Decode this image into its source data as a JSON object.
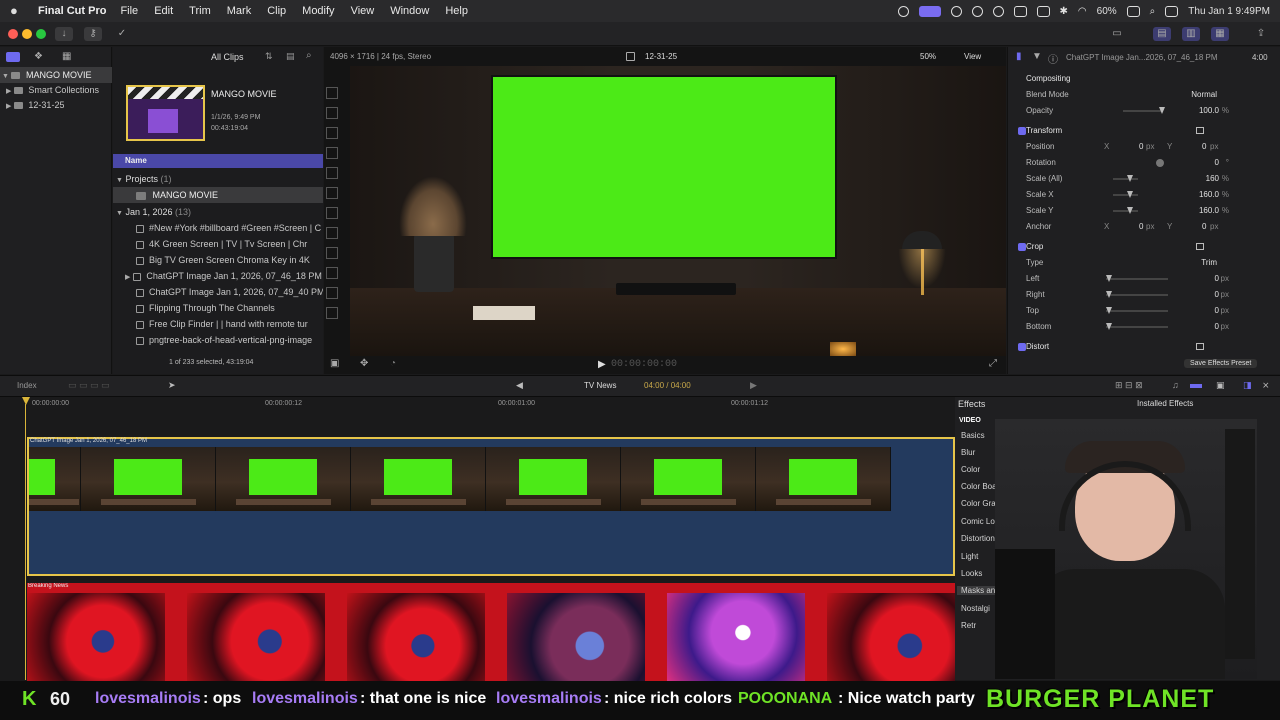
{
  "menubar": {
    "app_name": "Final Cut Pro",
    "items": [
      "File",
      "Edit",
      "Trim",
      "Mark",
      "Clip",
      "Modify",
      "View",
      "Window",
      "Help"
    ],
    "battery": "60%",
    "datetime": "Thu Jan 1  9:49PM"
  },
  "libraries": {
    "library": "MANGO MOVIE",
    "smart": "Smart Collections",
    "event": "12-31-25"
  },
  "browser": {
    "filter": "All Clips",
    "project_title": "MANGO MOVIE",
    "project_date": "1/1/26, 9:49 PM",
    "project_duration": "00:43:19:04",
    "column_name": "Name",
    "group_projects": "Projects",
    "group_projects_count": "(1)",
    "project_item": "MANGO MOVIE",
    "group_date": "Jan 1, 2026",
    "group_date_count": "(13)",
    "clips": [
      "#New #York #billboard #Green #Screen | C",
      "4K Green Screen  |  TV  |  Tv Screen  | Chr",
      "Big TV Green Screen Chroma Key in 4K",
      "ChatGPT Image Jan 1, 2026, 07_46_18 PM",
      "ChatGPT Image Jan 1, 2026, 07_49_40 PM",
      "Flipping Through The Channels",
      "Free Clip Finder  |  | hand with remote tur",
      "pngtree-back-of-head-vertical-png-image"
    ],
    "selection": "1 of 233 selected, 43:19:04"
  },
  "viewer": {
    "format": "4096 × 1716 | 24 fps, Stereo",
    "event": "12-31-25",
    "zoom": "50%",
    "view_label": "View",
    "timecode": "00:00:00:00"
  },
  "inspector": {
    "clip_name": "ChatGPT Image Jan...2026, 07_46_18 PM",
    "duration": "4:00",
    "compositing": "Compositing",
    "blend_mode_label": "Blend Mode",
    "blend_mode": "Normal",
    "opacity_label": "Opacity",
    "opacity": "100.0",
    "transform": "Transform",
    "position_label": "Position",
    "position_x": "0",
    "position_y": "0",
    "rotation_label": "Rotation",
    "rotation": "0",
    "scale_all_label": "Scale (All)",
    "scale_all": "160",
    "scale_x_label": "Scale X",
    "scale_x": "160.0",
    "scale_y_label": "Scale Y",
    "scale_y": "160.0",
    "anchor_label": "Anchor",
    "anchor_x": "0",
    "anchor_y": "0",
    "crop": "Crop",
    "type_label": "Type",
    "type": "Trim",
    "left_label": "Left",
    "left": "0",
    "right_label": "Right",
    "right": "0",
    "top_label": "Top",
    "top": "0",
    "bottom_label": "Bottom",
    "bottom": "0",
    "distort": "Distort",
    "save_preset": "Save Effects Preset",
    "unit_px": "px",
    "unit_pct": "%",
    "unit_deg": "°",
    "x": "X",
    "y": "Y"
  },
  "timeline_bar": {
    "index": "Index",
    "project": "TV News",
    "time": "04:00 / 04:00"
  },
  "timeline": {
    "ruler": [
      "00:00:00:00",
      "00:00:00:12",
      "00:00:01:00",
      "00:00:01:12"
    ],
    "clip_top": "ChatGPT Image Jan 1, 2026, 07_46_18 PM",
    "clip_bottom": "Breaking News"
  },
  "effects": {
    "title": "Effects",
    "installed": "Installed Effects",
    "section": "VIDEO",
    "items": [
      "Basics",
      "Blur",
      "Color",
      "Color Board Presets",
      "Color Grading Presets",
      "Comic Looks",
      "Distortion",
      "Light",
      "Looks",
      "Masks and",
      "Nostalgi",
      "Retr"
    ]
  },
  "chat": {
    "badge": "K",
    "count": "60",
    "messages": [
      {
        "user": "lovesmalinois",
        "text": ": ops"
      },
      {
        "user": "lovesmalinois",
        "text": ": that one is nice"
      },
      {
        "user": "lovesmalinois",
        "text": ": nice rich colors"
      },
      {
        "user": "POOONANA",
        "text": ": Nice watch party"
      }
    ],
    "sponsor": "BURGER PLANET"
  },
  "colors": {
    "accent": "#6e6af0",
    "green_screen": "#4cea17",
    "timeline_border": "#e6c54a",
    "chat_user": "#a77cf5",
    "sponsor": "#6fe326"
  }
}
